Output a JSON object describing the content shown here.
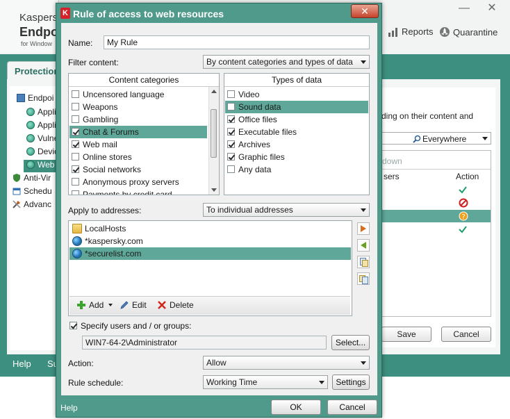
{
  "background": {
    "app_title_small": "Kaspersk",
    "app_title_big": "Endpoi",
    "app_title_sub": "for Window",
    "minimize": "—",
    "close": "✕",
    "header_links": [
      {
        "icon": "reports-icon",
        "label": "Reports"
      },
      {
        "icon": "quarantine-icon",
        "label": "Quarantine"
      }
    ],
    "protection_tab": "Protection",
    "tree_items": [
      {
        "label": "Endpoi",
        "icon": "monitor-icon",
        "indent": 0
      },
      {
        "label": "Appli",
        "icon": "globe-icon",
        "indent": 1
      },
      {
        "label": "Appli",
        "icon": "globe-icon",
        "indent": 1
      },
      {
        "label": "Vulne",
        "icon": "globe-icon",
        "indent": 1
      },
      {
        "label": "Devic",
        "icon": "globe-icon",
        "indent": 1
      },
      {
        "label": "Web",
        "icon": "globe-icon",
        "indent": 1,
        "selected": true
      },
      {
        "label": "Anti-Vir",
        "icon": "shield-icon",
        "indent": 0
      },
      {
        "label": "Schedu",
        "icon": "calendar-icon",
        "indent": 0
      },
      {
        "label": "Advanc",
        "icon": "tools-icon",
        "indent": 0
      }
    ],
    "right_panel": {
      "desc": "ding on their content and",
      "search_scope": "Everywhere",
      "toolbar_text": "down",
      "col_users": "sers",
      "col_action": "Action",
      "action_colors": {
        "allow": "#1e9e6a",
        "block": "#d21e1e",
        "warn": "#f0a020"
      }
    },
    "save": "Save",
    "cancel": "Cancel",
    "footer_help": "Help",
    "footer_other": "Su"
  },
  "dialog": {
    "title": "Rule of access to web resources",
    "logo_letter": "K",
    "close": "✕",
    "name_label": "Name:",
    "name_value": "My Rule",
    "filter_label": "Filter content:",
    "filter_value": "By content categories and types of data",
    "content_categories": {
      "header": "Content categories",
      "items": [
        {
          "label": "Uncensored language",
          "checked": false,
          "selected": false
        },
        {
          "label": "Weapons",
          "checked": false,
          "selected": false
        },
        {
          "label": "Gambling",
          "checked": false,
          "selected": false
        },
        {
          "label": "Chat & Forums",
          "checked": true,
          "selected": true
        },
        {
          "label": "Web mail",
          "checked": true,
          "selected": false
        },
        {
          "label": "Online stores",
          "checked": false,
          "selected": false
        },
        {
          "label": "Social networks",
          "checked": true,
          "selected": false
        },
        {
          "label": "Anonymous proxy servers",
          "checked": false,
          "selected": false
        },
        {
          "label": "Payments by credit card",
          "checked": false,
          "selected": false
        }
      ]
    },
    "types_of_data": {
      "header": "Types of data",
      "items": [
        {
          "label": "Video",
          "checked": false,
          "selected": false
        },
        {
          "label": "Sound data",
          "checked": false,
          "selected": true
        },
        {
          "label": "Office files",
          "checked": true,
          "selected": false
        },
        {
          "label": "Executable files",
          "checked": true,
          "selected": false
        },
        {
          "label": "Archives",
          "checked": true,
          "selected": false
        },
        {
          "label": "Graphic files",
          "checked": true,
          "selected": false
        },
        {
          "label": "Any data",
          "checked": false,
          "selected": false
        }
      ]
    },
    "apply_label": "Apply to addresses:",
    "apply_value": "To individual addresses",
    "addresses": [
      {
        "label": "LocalHosts",
        "icon": "folder-icon",
        "selected": false
      },
      {
        "label": "*kaspersky.com",
        "icon": "globe-icon",
        "selected": false
      },
      {
        "label": "*securelist.com",
        "icon": "globe-icon",
        "selected": true
      }
    ],
    "toolbar": {
      "add": "Add",
      "edit": "Edit",
      "delete": "Delete"
    },
    "specify_label": "Specify users and / or groups:",
    "specify_checked": true,
    "users_value": "WIN7-64-2\\Administrator",
    "select_button": "Select...",
    "action_label": "Action:",
    "action_value": "Allow",
    "schedule_label": "Rule schedule:",
    "schedule_value": "Working Time",
    "settings_button": "Settings",
    "help": "Help",
    "ok": "OK",
    "cancel": "Cancel"
  }
}
